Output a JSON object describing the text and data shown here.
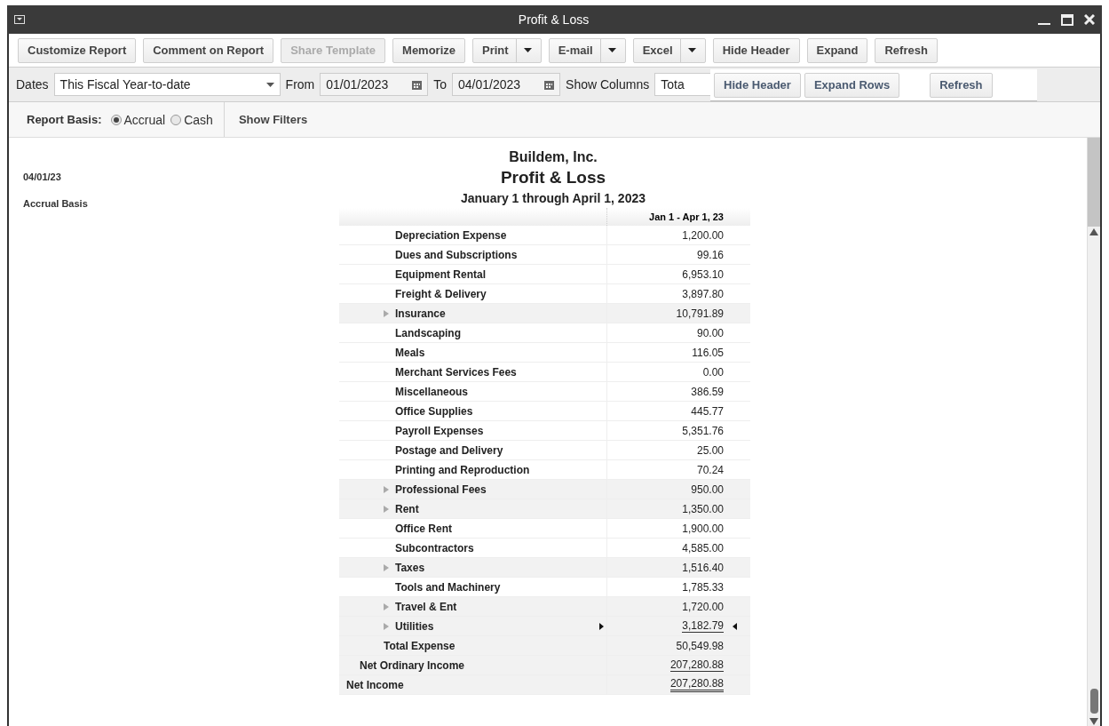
{
  "window": {
    "title": "Profit & Loss"
  },
  "toolbar": [
    {
      "label": "Customize Report",
      "kind": "button",
      "disabled": false
    },
    {
      "label": "Comment on Report",
      "kind": "button",
      "disabled": false
    },
    {
      "label": "Share Template",
      "kind": "button",
      "disabled": true
    },
    {
      "label": "Memorize",
      "kind": "button",
      "disabled": false
    },
    {
      "label": "Print",
      "kind": "split",
      "disabled": false
    },
    {
      "label": "E-mail",
      "kind": "split",
      "disabled": false
    },
    {
      "label": "Excel",
      "kind": "split",
      "disabled": false
    },
    {
      "label": "Hide Header",
      "kind": "button",
      "disabled": false
    },
    {
      "label": "Expand",
      "kind": "button",
      "disabled": false
    },
    {
      "label": "Refresh",
      "kind": "button",
      "disabled": false
    }
  ],
  "filter_bar": {
    "dates_label": "Dates",
    "dates_value": "This Fiscal Year-to-date",
    "from_label": "From",
    "from_value": "01/01/2023",
    "to_label": "To",
    "to_value": "04/01/2023",
    "columns_label": "Show Columns",
    "columns_value": "Tota"
  },
  "popup": {
    "buttons": [
      "Hide Header",
      "Expand Rows",
      "Refresh"
    ]
  },
  "basis_bar": {
    "label": "Report Basis:",
    "options": [
      {
        "label": "Accrual",
        "selected": true
      },
      {
        "label": "Cash",
        "selected": false
      }
    ],
    "show_filters": "Show Filters"
  },
  "report": {
    "date": "04/01/23",
    "basis": "Accrual Basis",
    "company": "Buildem, Inc.",
    "title": "Profit & Loss",
    "period": "January 1 through April 1, 2023",
    "column_header": "Jan 1 - Apr 1, 23",
    "rows": [
      {
        "label": "Depreciation Expense",
        "amount": "1,200.00",
        "kind": "account",
        "expandable": false,
        "selected": false
      },
      {
        "label": "Dues and Subscriptions",
        "amount": "99.16",
        "kind": "account",
        "expandable": false,
        "selected": false
      },
      {
        "label": "Equipment Rental",
        "amount": "6,953.10",
        "kind": "account",
        "expandable": false,
        "selected": false
      },
      {
        "label": "Freight & Delivery",
        "amount": "3,897.80",
        "kind": "account",
        "expandable": false,
        "selected": false
      },
      {
        "label": "Insurance",
        "amount": "10,791.89",
        "kind": "account",
        "expandable": true,
        "selected": false
      },
      {
        "label": "Landscaping",
        "amount": "90.00",
        "kind": "account",
        "expandable": false,
        "selected": false
      },
      {
        "label": "Meals",
        "amount": "116.05",
        "kind": "account",
        "expandable": false,
        "selected": false
      },
      {
        "label": "Merchant Services Fees",
        "amount": "0.00",
        "kind": "account",
        "expandable": false,
        "selected": false
      },
      {
        "label": "Miscellaneous",
        "amount": "386.59",
        "kind": "account",
        "expandable": false,
        "selected": false
      },
      {
        "label": "Office Supplies",
        "amount": "445.77",
        "kind": "account",
        "expandable": false,
        "selected": false
      },
      {
        "label": "Payroll Expenses",
        "amount": "5,351.76",
        "kind": "account",
        "expandable": false,
        "selected": false
      },
      {
        "label": "Postage and Delivery",
        "amount": "25.00",
        "kind": "account",
        "expandable": false,
        "selected": false
      },
      {
        "label": "Printing and Reproduction",
        "amount": "70.24",
        "kind": "account",
        "expandable": false,
        "selected": false
      },
      {
        "label": "Professional Fees",
        "amount": "950.00",
        "kind": "account",
        "expandable": true,
        "selected": false
      },
      {
        "label": "Rent",
        "amount": "1,350.00",
        "kind": "account",
        "expandable": true,
        "selected": false
      },
      {
        "label": "Office Rent",
        "amount": "1,900.00",
        "kind": "account",
        "expandable": false,
        "selected": false
      },
      {
        "label": "Subcontractors",
        "amount": "4,585.00",
        "kind": "account",
        "expandable": false,
        "selected": false
      },
      {
        "label": "Taxes",
        "amount": "1,516.40",
        "kind": "account",
        "expandable": true,
        "selected": false
      },
      {
        "label": "Tools and Machinery",
        "amount": "1,785.33",
        "kind": "account",
        "expandable": false,
        "selected": false
      },
      {
        "label": "Travel & Ent",
        "amount": "1,720.00",
        "kind": "account",
        "expandable": true,
        "selected": false
      },
      {
        "label": "Utilities",
        "amount": "3,182.79",
        "kind": "account",
        "expandable": true,
        "selected": true,
        "underlined": true
      },
      {
        "label": "Total Expense",
        "amount": "50,549.98",
        "kind": "total",
        "expandable": false,
        "selected": false
      },
      {
        "label": "Net Ordinary Income",
        "amount": "207,280.88",
        "kind": "subtotal",
        "expandable": false,
        "selected": false,
        "underlined": true
      },
      {
        "label": "Net Income",
        "amount": "207,280.88",
        "kind": "grand",
        "expandable": false,
        "selected": false,
        "double_underlined": true
      }
    ]
  }
}
